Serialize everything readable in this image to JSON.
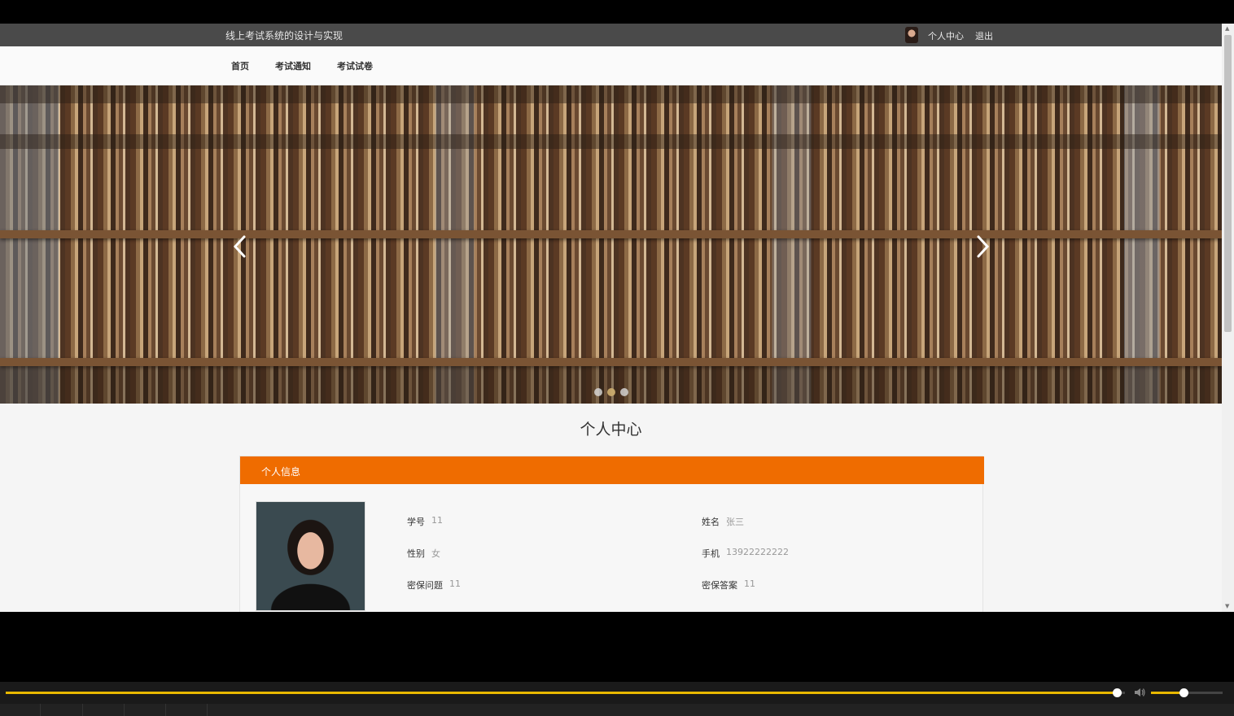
{
  "site": {
    "title": "线上考试系统的设计与实现",
    "user_center": "个人中心",
    "logout": "退出"
  },
  "nav": {
    "items": [
      {
        "label": "首页"
      },
      {
        "label": "考试通知"
      },
      {
        "label": "考试试卷"
      }
    ]
  },
  "banner": {
    "slides": 3,
    "active_slide": 1,
    "prev_icon": "chevron-left-icon",
    "next_icon": "chevron-right-icon"
  },
  "section": {
    "title": "个人中心"
  },
  "profile": {
    "header": "个人信息",
    "fields": {
      "student_id": {
        "label": "学号",
        "value": "11"
      },
      "name": {
        "label": "姓名",
        "value": "张三"
      },
      "gender": {
        "label": "性别",
        "value": "女"
      },
      "phone": {
        "label": "手机",
        "value": "13922222222"
      },
      "security_question": {
        "label": "密保问题",
        "value": "11"
      },
      "security_answer": {
        "label": "密保答案",
        "value": "11"
      }
    }
  },
  "player": {
    "progress": 0.993,
    "volume": 0.45,
    "accent_color": "#e8b800"
  },
  "colors": {
    "topbar": "#4a4a4a",
    "panel_header": "#ef6c00"
  }
}
